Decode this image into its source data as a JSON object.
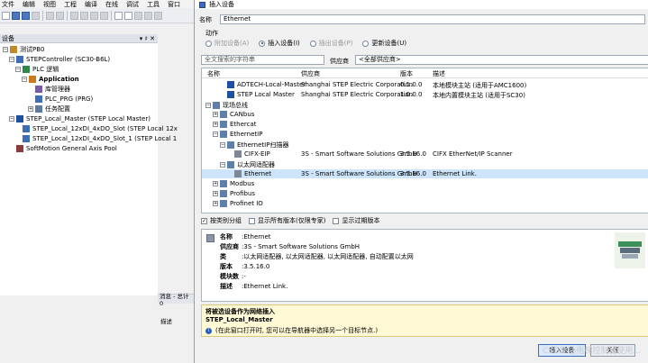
{
  "menubar": [
    "文件",
    "编辑",
    "视图",
    "工程",
    "编译",
    "在线",
    "调试",
    "工具",
    "窗口"
  ],
  "devices_pane": {
    "title": "设备",
    "pin": "▾ ♯ ✕",
    "tree": [
      {
        "label": "测试PB0",
        "indent": 0,
        "toggle": "−",
        "icon": "project-icon"
      },
      {
        "label": "STEPController (SC30-B6L)",
        "indent": 1,
        "toggle": "−",
        "icon": "controller-icon"
      },
      {
        "label": "PLC 逻辑",
        "indent": 2,
        "toggle": "−",
        "icon": "plc-logic-icon"
      },
      {
        "label": "Application",
        "indent": 3,
        "toggle": "−",
        "icon": "application-icon",
        "bold": true
      },
      {
        "label": "库管理器",
        "indent": 4,
        "toggle": "",
        "icon": "library-icon"
      },
      {
        "label": "PLC_PRG (PRG)",
        "indent": 4,
        "toggle": "",
        "icon": "program-icon"
      },
      {
        "label": "任务配置",
        "indent": 4,
        "toggle": "+",
        "icon": "task-config-icon"
      },
      {
        "label": "STEP_Local_Master (STEP Local Master)",
        "indent": 1,
        "toggle": "−",
        "icon": "bus-master-icon"
      },
      {
        "label": "STEP_Local_12xDI_4xDO_Slot (STEP Local 12x",
        "indent": 2,
        "toggle": "",
        "icon": "io-module-icon"
      },
      {
        "label": "STEP_Local_12xDI_4xDO_Slot_1 (STEP Local 1",
        "indent": 2,
        "toggle": "",
        "icon": "io-module-icon"
      },
      {
        "label": "SoftMotion General Axis Pool",
        "indent": 1,
        "toggle": "",
        "icon": "axis-pool-icon"
      }
    ]
  },
  "left_bottom": {
    "tabs": "消息 - 总计 0",
    "desc": "描述"
  },
  "dialog": {
    "title": "插入设备",
    "name_label": "名称",
    "name_value": "Ethernet",
    "action_label": "动作",
    "actions": [
      {
        "label": "附加设备(A)",
        "selected": false,
        "enabled": false
      },
      {
        "label": "插入设备(I)",
        "selected": true,
        "enabled": true
      },
      {
        "label": "插出设备(P)",
        "selected": false,
        "enabled": false
      },
      {
        "label": "更新设备(U)",
        "selected": false,
        "enabled": true
      }
    ],
    "search_placeholder": "全文搜索的字符串",
    "vendor_label": "供应商",
    "vendor_value": "<全部供应商>",
    "columns": [
      "名称",
      "供应商",
      "版本",
      "描述"
    ],
    "rows": [
      {
        "indent": 2,
        "toggle": "",
        "icon": "device-blue-icon",
        "name": "ADTECH-Local-Master",
        "vendor": "Shanghai STEP Electric Corporation",
        "version": "0.1.0.0",
        "desc": "本地模块主站 (适用于AMC1600)"
      },
      {
        "indent": 2,
        "toggle": "",
        "icon": "device-blue-icon",
        "name": "STEP Local Master",
        "vendor": "Shanghai STEP Electric Corporation",
        "version": "1.0.0.0",
        "desc": "本地内置模块主站 (适用于SC30)"
      },
      {
        "indent": 0,
        "toggle": "−",
        "icon": "fieldbus-icon",
        "name": "现场总线",
        "vendor": "",
        "version": "",
        "desc": ""
      },
      {
        "indent": 1,
        "toggle": "+",
        "icon": "canbus-icon",
        "name": "CANbus",
        "vendor": "",
        "version": "",
        "desc": ""
      },
      {
        "indent": 1,
        "toggle": "+",
        "icon": "ethercat-icon",
        "name": "Ethercat",
        "vendor": "",
        "version": "",
        "desc": ""
      },
      {
        "indent": 1,
        "toggle": "−",
        "icon": "ethernetip-icon",
        "name": "EthernetIP",
        "vendor": "",
        "version": "",
        "desc": ""
      },
      {
        "indent": 2,
        "toggle": "−",
        "icon": "scanner-icon",
        "name": "EthernetIP扫描器",
        "vendor": "",
        "version": "",
        "desc": ""
      },
      {
        "indent": 3,
        "toggle": "",
        "icon": "device-icon",
        "name": "CIFX-EIP",
        "vendor": "3S - Smart Software Solutions GmbH",
        "version": "3.5.16.0",
        "desc": "CIFX EtherNet/IP Scanner"
      },
      {
        "indent": 2,
        "toggle": "−",
        "icon": "ethernet-adapter-icon",
        "name": "以太网适配器",
        "vendor": "",
        "version": "",
        "desc": ""
      },
      {
        "indent": 3,
        "toggle": "",
        "icon": "device-icon",
        "name": "Ethernet",
        "vendor": "3S - Smart Software Solutions GmbH",
        "version": "3.5.16.0",
        "desc": "Ethernet Link.",
        "selected": true
      },
      {
        "indent": 1,
        "toggle": "+",
        "icon": "modbus-icon",
        "name": "Modbus",
        "vendor": "",
        "version": "",
        "desc": ""
      },
      {
        "indent": 1,
        "toggle": "+",
        "icon": "profibus-icon",
        "name": "Profibus",
        "vendor": "",
        "version": "",
        "desc": ""
      },
      {
        "indent": 1,
        "toggle": "+",
        "icon": "profinet-icon",
        "name": "Profinet IO",
        "vendor": "",
        "version": "",
        "desc": ""
      }
    ],
    "options": [
      {
        "label": "按类别分组",
        "checked": true
      },
      {
        "label": "显示所有版本(仅限专家)",
        "checked": false
      },
      {
        "label": "显示过期版本",
        "checked": false
      }
    ],
    "details": [
      {
        "key": "名称",
        "value": "Ethernet"
      },
      {
        "key": "供应商",
        "value": "3S - Smart Software Solutions GmbH"
      },
      {
        "key": "类",
        "value": "以太网适配器,  以太网适配器,  以太网适配器,  自动配置以太网"
      },
      {
        "key": "版本",
        "value": "3.5.16.0"
      },
      {
        "key": "模块数",
        "value": "-"
      },
      {
        "key": "描述",
        "value": "Ethernet Link."
      }
    ],
    "msg_title": "将被选设备作为网络插入",
    "msg_target": "STEP_Local_Master",
    "msg_info": "(在此窗口打开时, 您可以在导航器中选择另一个目标节点.)",
    "insert_button": "插入设备",
    "close_button": "关闭"
  },
  "watermark": "CSDN @电梯控制器使用..."
}
